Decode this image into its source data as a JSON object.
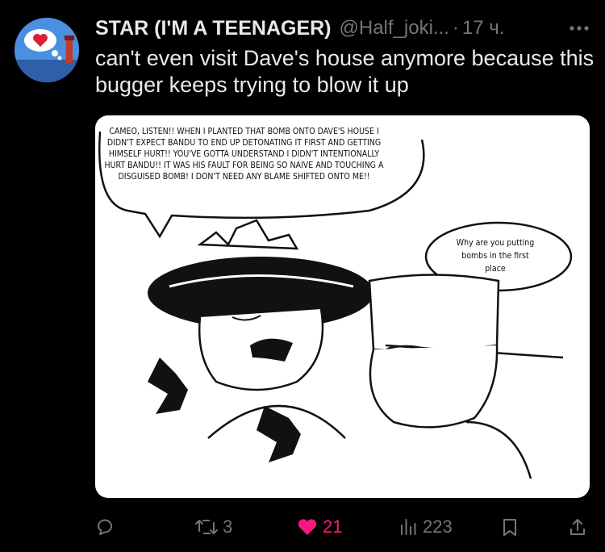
{
  "tweet": {
    "display_name": "STAR (I'M A TEENAGER)",
    "handle": "@Half_joki...",
    "separator": "·",
    "time": "17 ч.",
    "text": "can't even visit Dave's house anymore because this bugger keeps trying to blow it up"
  },
  "media": {
    "speech_bubble_1": "CAMEO, LISTEN!! WHEN I PLANTED THAT BOMB ONTO DAVE'S HOUSE I DIDN'T EXPECT BANDU TO END UP DETONATING IT FIRST AND GETTING HIMSELF HURT!! YOU'VE GOTTA UNDERSTAND I DIDN'T INTENTIONALLY HURT BANDU!! IT WAS HIS FAULT FOR BEING SO NAIVE AND TOUCHING A DISGUISED BOMB! I DON'T NEED ANY BLAME SHIFTED ONTO ME!!",
    "speech_bubble_2": "Why are you putting bombs in the first place"
  },
  "actions": {
    "reply_count": "",
    "retweet_count": "3",
    "like_count": "21",
    "views_count": "223"
  },
  "colors": {
    "background": "#000000",
    "text": "#e7e9ea",
    "secondary": "#71767b",
    "like": "#f91880"
  }
}
